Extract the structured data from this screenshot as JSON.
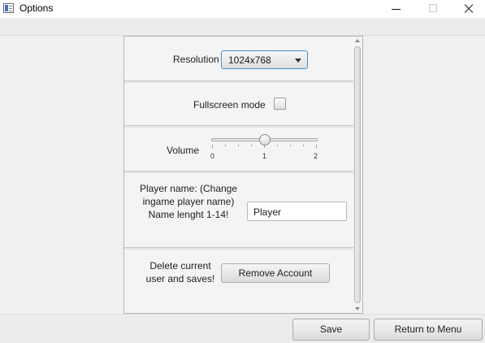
{
  "window": {
    "title": "Options"
  },
  "resolution": {
    "label": "Resolution",
    "selected": "1024x768"
  },
  "fullscreen": {
    "label": "Fullscreen mode",
    "checked": false
  },
  "volume": {
    "label": "Volume",
    "min": 0,
    "max": 2,
    "value": 1,
    "tick_labels": [
      "0",
      "1",
      "2"
    ]
  },
  "player": {
    "label_lines": [
      "Player name: (Change",
      "ingame player name)",
      "Name lenght 1-14!"
    ],
    "value": "Player"
  },
  "account": {
    "label_lines": [
      "Delete current",
      "user and saves!"
    ],
    "remove_label": "Remove Account"
  },
  "footer": {
    "save_label": "Save",
    "return_label": "Return to Menu"
  },
  "colors": {
    "focus_border": "#3c8fd6",
    "background": "#f0f0f0"
  },
  "icons": [
    "app-window-icon",
    "minimize-icon",
    "maximize-icon",
    "close-icon",
    "dropdown-arrow-icon",
    "scroll-up-arrow-icon",
    "scroll-down-arrow-icon"
  ]
}
